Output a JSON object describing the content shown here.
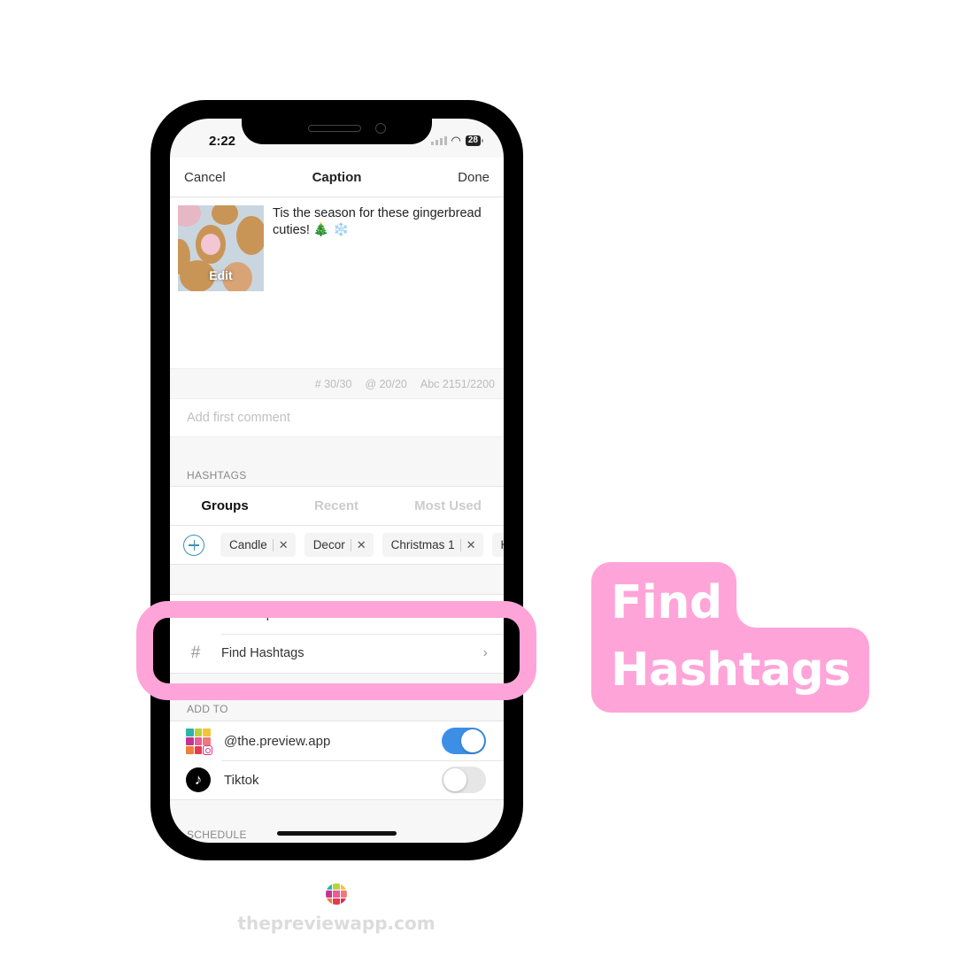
{
  "status_bar": {
    "time": "2:22",
    "battery": "28"
  },
  "nav": {
    "cancel": "Cancel",
    "title": "Caption",
    "done": "Done"
  },
  "post": {
    "thumbnail_alt": "gingerbread cookies photo",
    "edit_label": "Edit",
    "caption": "Tis the season for these gingerbread cuties! 🎄 ❄️"
  },
  "counters": {
    "hashtags": "# 30/30",
    "mentions": "@ 20/20",
    "characters": "Abc 2151/2200"
  },
  "comment": {
    "placeholder": "Add first comment",
    "value": ""
  },
  "hashtags": {
    "section_label": "HASHTAGS",
    "tabs": [
      {
        "label": "Groups",
        "active": true
      },
      {
        "label": "Recent",
        "active": false
      },
      {
        "label": "Most Used",
        "active": false
      }
    ],
    "groups": [
      "Candle",
      "Decor",
      "Christmas 1",
      "H"
    ]
  },
  "menu": {
    "items": [
      {
        "icon": "captions-icon",
        "label": "Find Captions"
      },
      {
        "icon": "hash-icon",
        "label": "Find Hashtags"
      }
    ]
  },
  "add_to": {
    "section_label": "ADD TO",
    "accounts": [
      {
        "name": "@the.preview.app",
        "enabled": true
      },
      {
        "name": "Tiktok",
        "enabled": false
      }
    ]
  },
  "schedule": {
    "section_label": "SCHEDULE"
  },
  "callout": {
    "line1": "Find",
    "line2": "Hashtags",
    "color": "#ffa4d8"
  },
  "footer": {
    "url": "thepreviewapp.com"
  },
  "colors": {
    "toggle_on": "#3d8fe6",
    "accent_add": "#3d8fb8",
    "highlight": "#ffa4d8"
  }
}
